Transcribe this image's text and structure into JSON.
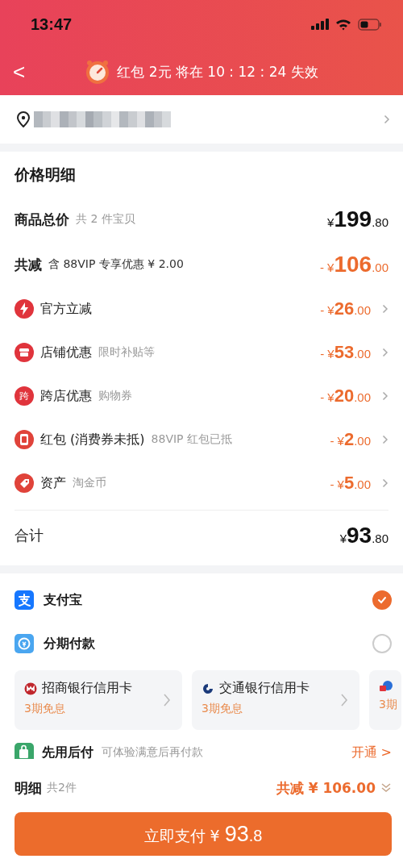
{
  "status_bar": {
    "time": "13:47"
  },
  "nav": {
    "back": "<",
    "title": "红包 2元 将在 10 : 12 : 24 失效"
  },
  "address": {
    "blurred": true
  },
  "price_detail": {
    "title": "价格明细",
    "total": {
      "label": "商品总价",
      "note": "共 2 件宝贝",
      "prefix": "¥",
      "int": "199",
      "dec": ".80"
    },
    "discount": {
      "label": "共减",
      "note": "含 88VIP 专享优惠 ¥ 2.00",
      "prefix": "- ¥",
      "int": "106",
      "dec": ".00"
    },
    "items": [
      {
        "kind": "bolt",
        "label": "官方立减",
        "prefix": "- ¥",
        "int": "26",
        "dec": ".00"
      },
      {
        "kind": "store",
        "label": "店铺优惠",
        "note": "限时补贴等",
        "prefix": "- ¥",
        "int": "53",
        "dec": ".00"
      },
      {
        "kind": "glyph",
        "glyph": "跨",
        "label": "跨店优惠",
        "note": "购物券",
        "prefix": "- ¥",
        "int": "20",
        "dec": ".00"
      },
      {
        "kind": "packet",
        "label": "红包 (消费券未抵)",
        "note": "88VIP 红包已抵",
        "prefix": "- ¥",
        "int": "2",
        "dec": ".00"
      },
      {
        "kind": "tag",
        "label": "资产",
        "note": "淘金币",
        "prefix": "- ¥",
        "int": "5",
        "dec": ".00"
      }
    ],
    "sum": {
      "label": "合计",
      "prefix": "¥",
      "int": "93",
      "dec": ".80"
    }
  },
  "payment": {
    "methods": [
      {
        "kind": "alipay",
        "label": "支付宝",
        "selected": true
      },
      {
        "kind": "installment",
        "label": "分期付款",
        "selected": false
      }
    ],
    "cards": [
      {
        "kind": "cmb",
        "name": "招商银行信用卡",
        "offer": "3期免息"
      },
      {
        "kind": "bocom",
        "name": "交通银行信用卡",
        "offer": "3期免息"
      },
      {
        "kind": "other",
        "offer": "3期"
      }
    ],
    "later": {
      "label": "先用后付",
      "note": "可体验满意后再付款",
      "action": "开通 >"
    }
  },
  "footer": {
    "label": "明细",
    "count": "共2件",
    "saving": "共减 ¥ 106.00",
    "pay": {
      "label": "立即支付 ¥",
      "int": "93",
      "dec": ".8"
    }
  }
}
